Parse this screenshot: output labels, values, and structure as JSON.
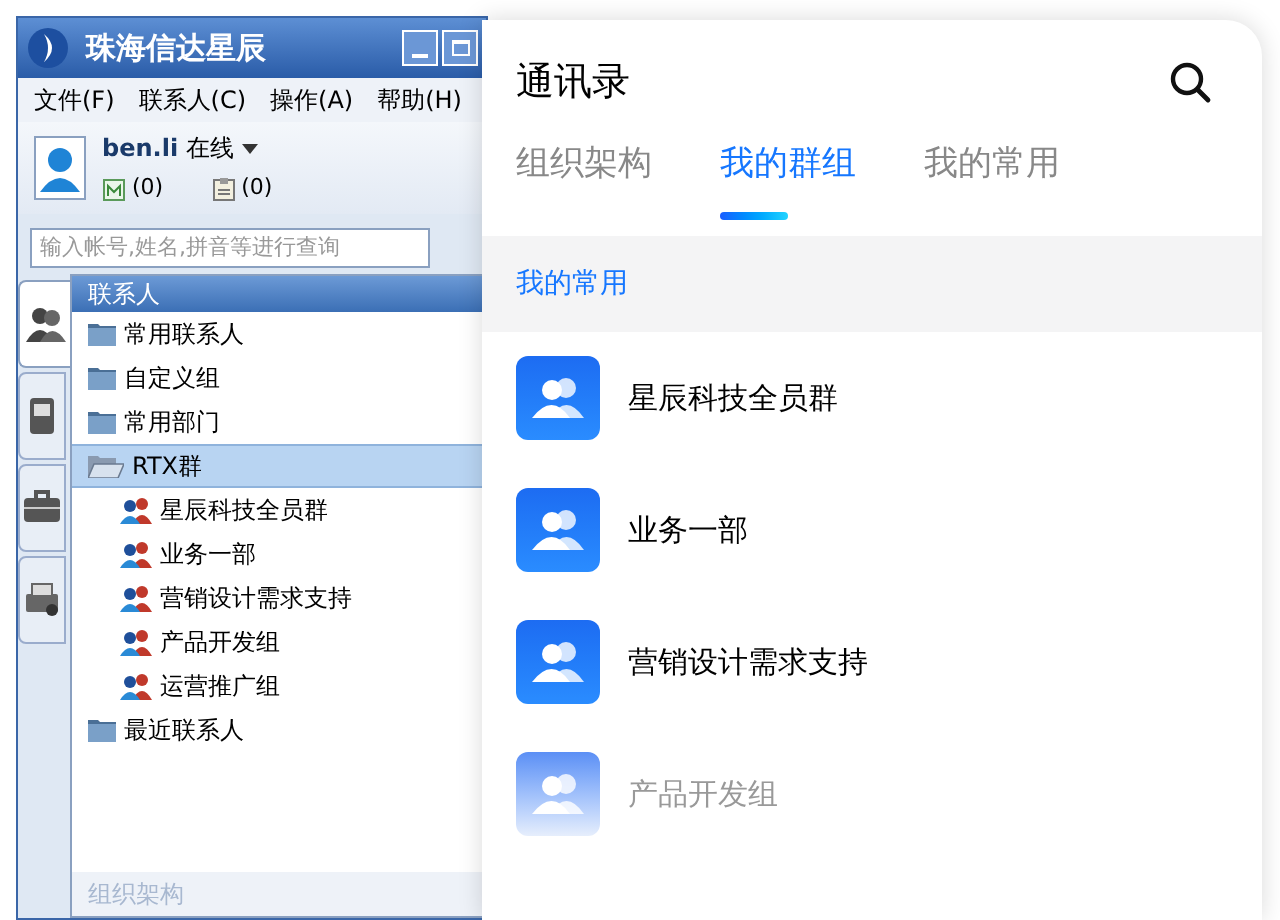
{
  "desktop_window": {
    "title": "珠海信达星辰",
    "menu": [
      "文件(F)",
      "联系人(C)",
      "操作(A)",
      "帮助(H)"
    ],
    "user": {
      "name": "ben.li",
      "status": "在线"
    },
    "counters": [
      "(0)",
      "(0)"
    ],
    "search": {
      "placeholder": "输入帐号,姓名,拼音等进行查询"
    },
    "side_tabs": [
      {
        "kind": "contacts",
        "selected": true
      },
      {
        "kind": "phone",
        "selected": false
      },
      {
        "kind": "briefcase",
        "selected": false
      },
      {
        "kind": "printer",
        "selected": false
      }
    ],
    "tree_header": "联系人",
    "tree": [
      {
        "label": "常用联系人",
        "kind": "folder",
        "selected": false
      },
      {
        "label": "自定义组",
        "kind": "folder",
        "selected": false
      },
      {
        "label": "常用部门",
        "kind": "folder",
        "selected": false
      },
      {
        "label": "RTX群",
        "kind": "folder",
        "selected": true,
        "expanded": true,
        "children": [
          {
            "label": "星辰科技全员群",
            "kind": "group",
            "selected": false
          },
          {
            "label": "业务一部",
            "kind": "group",
            "selected": false
          },
          {
            "label": "营销设计需求支持",
            "kind": "group",
            "selected": false
          },
          {
            "label": "产品开发组",
            "kind": "group",
            "selected": false
          },
          {
            "label": "运营推广组",
            "kind": "group",
            "selected": false
          }
        ]
      },
      {
        "label": "最近联系人",
        "kind": "folder",
        "selected": false
      }
    ],
    "bottom_tab": "组织架构"
  },
  "mobile_panel": {
    "title": "通讯录",
    "tabs": [
      {
        "label": "组织架构",
        "selected": false
      },
      {
        "label": "我的群组",
        "selected": true
      },
      {
        "label": "我的常用",
        "selected": false
      }
    ],
    "section_header": "我的常用",
    "groups": [
      {
        "name": "星辰科技全员群",
        "dimmed": false
      },
      {
        "name": "业务一部",
        "dimmed": false
      },
      {
        "name": "营销设计需求支持",
        "dimmed": false
      },
      {
        "name": "产品开发组",
        "dimmed": true
      }
    ]
  }
}
